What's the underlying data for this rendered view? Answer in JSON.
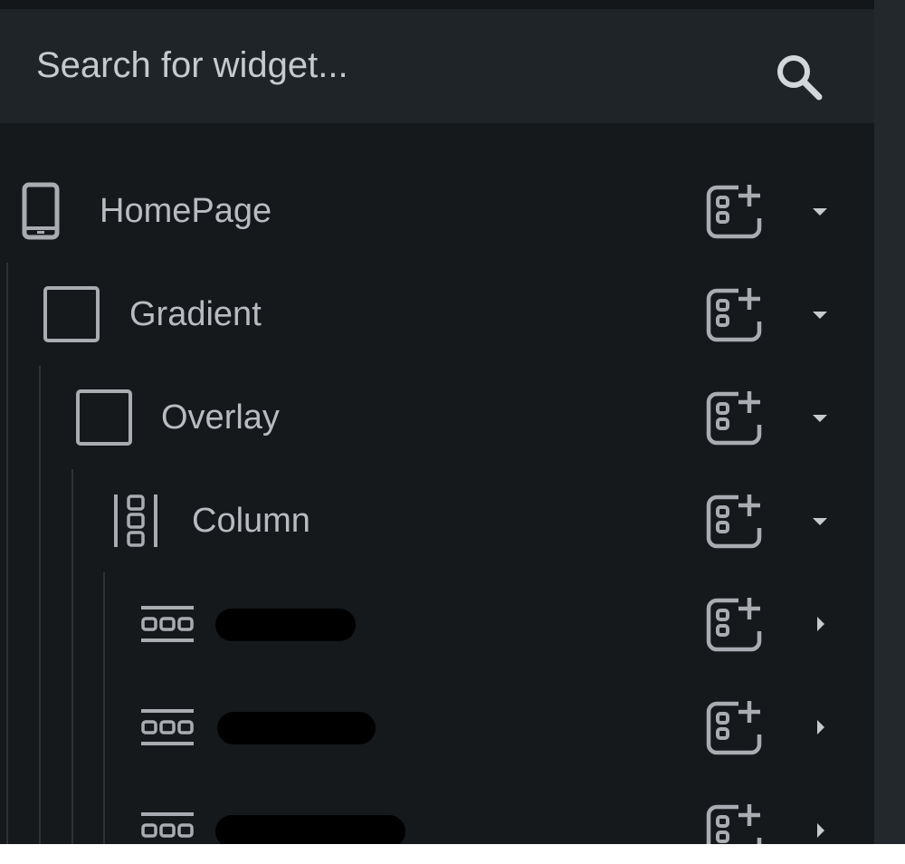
{
  "search": {
    "placeholder": "Search for widget..."
  },
  "tree": {
    "rows": [
      {
        "label": "HomePage",
        "icon": "phone-icon",
        "expanded": true
      },
      {
        "label": "Gradient",
        "icon": "container-icon",
        "expanded": true
      },
      {
        "label": "Overlay",
        "icon": "container-icon",
        "expanded": true
      },
      {
        "label": "Column",
        "icon": "column-icon",
        "expanded": true
      },
      {
        "label": "",
        "icon": "row-widget-icon",
        "expanded": false,
        "redacted": true
      },
      {
        "label": "",
        "icon": "row-widget-icon",
        "expanded": false,
        "redacted": true
      },
      {
        "label": "",
        "icon": "row-widget-icon",
        "expanded": false,
        "redacted": true
      }
    ]
  },
  "colors": {
    "background": "#16191c",
    "search_background": "#1f2428",
    "text": "#b8bcc0",
    "icon": "#a9adb1"
  }
}
